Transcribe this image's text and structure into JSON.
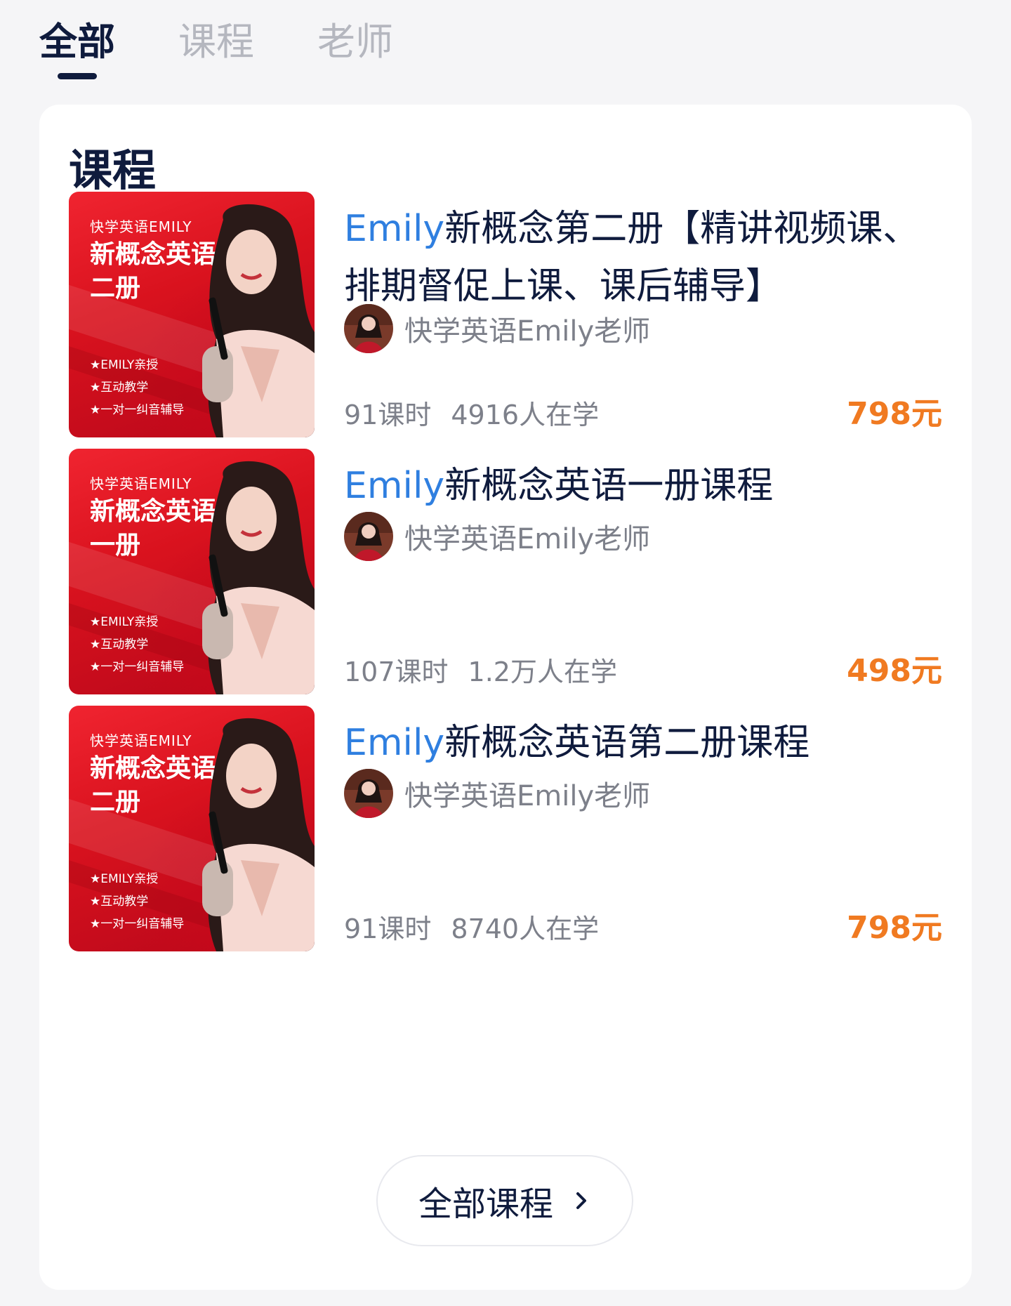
{
  "tabs": [
    {
      "label": "全部",
      "active": true
    },
    {
      "label": "课程",
      "active": false
    },
    {
      "label": "老师",
      "active": false
    }
  ],
  "section": {
    "title": "课程"
  },
  "courses": [
    {
      "thumbnail": {
        "brand": "快学英语EMILY",
        "headline_line1": "新概念英语",
        "headline_line2": "二册",
        "features": [
          "★EMILY亲授",
          "★互动教学",
          "★一对一纠音辅导"
        ]
      },
      "title_highlight": "Emily",
      "title_rest": "新概念第二册【精讲视频课、排期督促上课、课后辅导】",
      "teacher": "快学英语Emily老师",
      "lessons": "91课时",
      "learners": "4916人在学",
      "price": "798元"
    },
    {
      "thumbnail": {
        "brand": "快学英语EMILY",
        "headline_line1": "新概念英语",
        "headline_line2": "一册",
        "features": [
          "★EMILY亲授",
          "★互动教学",
          "★一对一纠音辅导"
        ]
      },
      "title_highlight": "Emily",
      "title_rest": "新概念英语一册课程",
      "teacher": "快学英语Emily老师",
      "lessons": "107课时",
      "learners": "1.2万人在学",
      "price": "498元"
    },
    {
      "thumbnail": {
        "brand": "快学英语EMILY",
        "headline_line1": "新概念英语",
        "headline_line2": "二册",
        "features": [
          "★EMILY亲授",
          "★互动教学",
          "★一对一纠音辅导"
        ]
      },
      "title_highlight": "Emily",
      "title_rest": "新概念英语第二册课程",
      "teacher": "快学英语Emily老师",
      "lessons": "91课时",
      "learners": "8740人在学",
      "price": "798元"
    }
  ],
  "all_courses_button": {
    "label": "全部课程",
    "icon": "chevron-right-icon"
  },
  "colors": {
    "primary_text": "#0f1b3d",
    "highlight": "#2f7fe0",
    "price": "#f07a21",
    "muted": "#7d808a",
    "inactive_tab": "#b5b7bf",
    "thumbnail_red": "#e0141f",
    "background": "#f5f5f7",
    "card": "#ffffff"
  }
}
